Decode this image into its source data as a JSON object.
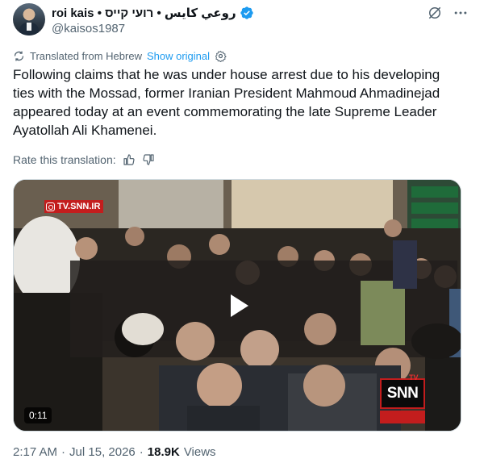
{
  "author": {
    "display_name": "roi kais • روعي كايس • רועי קייס",
    "handle": "@kaisos1987",
    "verified": true,
    "avatar_icon": "profile-photo"
  },
  "translation": {
    "notice": "Translated from Hebrew",
    "show_original": "Show original",
    "rate_label": "Rate this translation:"
  },
  "tweet": {
    "text": "Following claims that he was under house arrest due to his developing ties with the Mossad, former Iranian President Mahmoud Ahmadinejad appeared today at an event commemorating the late Supreme Leader Ayatollah Ali Khamenei."
  },
  "media": {
    "watermark": "TV.SNN.IR",
    "duration": "0:11",
    "logo_text": "SNN",
    "logo_tv": "TV"
  },
  "meta": {
    "time": "2:17 AM",
    "separator": "·",
    "date": "Jul 15, 2026",
    "views_count": "18.9K",
    "views_label": "Views"
  },
  "colors": {
    "accent": "#1d9bf0",
    "text": "#0f1419",
    "secondary": "#536471",
    "snn_red": "#c31d1d"
  }
}
